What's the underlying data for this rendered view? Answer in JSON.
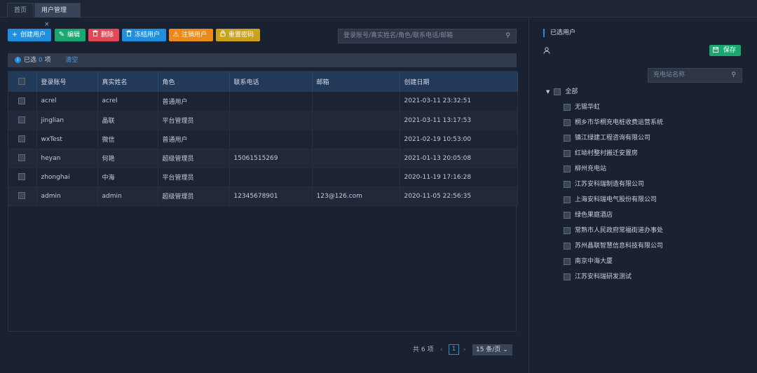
{
  "tabs": [
    {
      "label": "首页"
    },
    {
      "label": "用户管理",
      "close": "×"
    }
  ],
  "toolbar": {
    "create": "创建用户",
    "edit": "编辑",
    "delete": "删除",
    "freeze": "冻结用户",
    "cancel": "注销用户",
    "reset": "重置密码"
  },
  "search": {
    "placeholder": "登录账号/真实姓名/角色/联系电话/邮箱"
  },
  "selection": {
    "prefix": "已选",
    "count": "0",
    "suffix": "项",
    "clear": "清空"
  },
  "table": {
    "columns": [
      "登录账号",
      "真实姓名",
      "角色",
      "联系电话",
      "邮箱",
      "创建日期"
    ],
    "rows": [
      {
        "account": "acrel",
        "name": "acrel",
        "role": "普通用户",
        "phone": "",
        "email": "",
        "created": "2021-03-11 23:32:51"
      },
      {
        "account": "jinglian",
        "name": "晶联",
        "role": "平台管理员",
        "phone": "",
        "email": "",
        "created": "2021-03-11 13:17:53"
      },
      {
        "account": "wxTest",
        "name": "微信",
        "role": "普通用户",
        "phone": "",
        "email": "",
        "created": "2021-02-19 10:53:00"
      },
      {
        "account": "heyan",
        "name": "何艳",
        "role": "超级管理员",
        "phone": "15061515269",
        "email": "",
        "created": "2021-01-13 20:05:08"
      },
      {
        "account": "zhonghai",
        "name": "中海",
        "role": "平台管理员",
        "phone": "",
        "email": "",
        "created": "2020-11-19 17:16:28"
      },
      {
        "account": "admin",
        "name": "admin",
        "role": "超级管理员",
        "phone": "12345678901",
        "email": "123@126.com",
        "created": "2020-11-05 22:56:35"
      }
    ]
  },
  "pager": {
    "total": "共 6 项",
    "page": "1",
    "size": "15 条/页"
  },
  "right_panel": {
    "title": "已选用户",
    "save": "保存",
    "search_placeholder": "充电站名称",
    "root": "全部",
    "stations": [
      "无锡华虹",
      "桐乡市华桐充电桩收费运营系统",
      "镇江绿建工程咨询有限公司",
      "红坳村整村搬迁安置房",
      "柳州充电站",
      "江苏安科瑞制造有限公司",
      "上海安科瑞电气股份有限公司",
      "绿色果庭酒店",
      "常熟市人民政府常福街道办事处",
      "苏州晶联智慧信息科技有限公司",
      "南京中海大厦",
      "江苏安科瑞研发测试"
    ]
  },
  "colors": {
    "primary": "#1f8fe0",
    "success": "#1ba870",
    "danger": "#e04a58",
    "warning": "#e98a1c",
    "gold": "#c9a41a"
  }
}
